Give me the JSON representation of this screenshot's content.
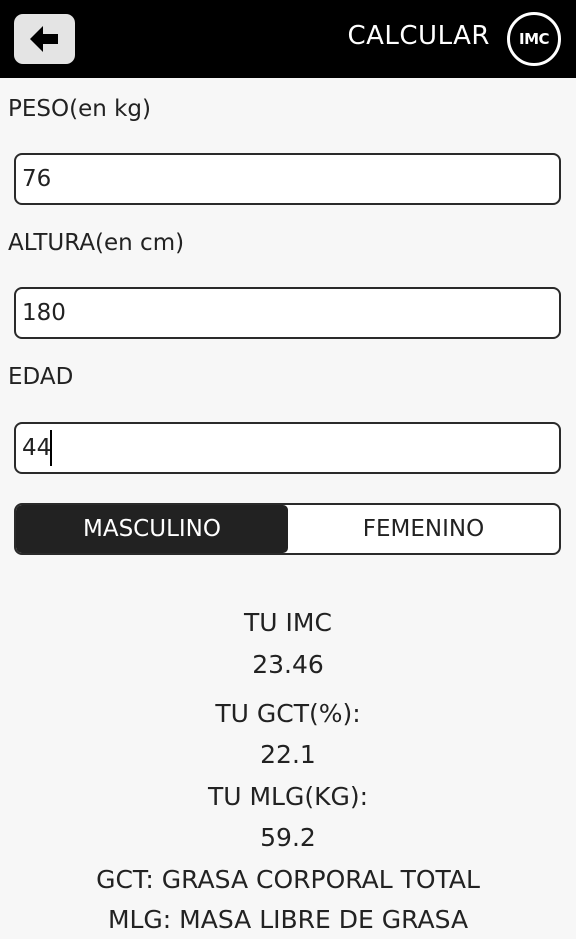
{
  "header": {
    "back_icon": "arrow-left-icon",
    "action_label": "CALCULAR",
    "badge_text": "IMC"
  },
  "form": {
    "weight": {
      "label": "PESO(en kg)",
      "value": "76"
    },
    "height": {
      "label": "ALTURA(en cm)",
      "value": "180"
    },
    "age": {
      "label": "EDAD",
      "value": "44"
    }
  },
  "gender": {
    "options": [
      "MASCULINO",
      "FEMENINO"
    ],
    "selected": "MASCULINO"
  },
  "results": {
    "imc_label": "TU IMC",
    "imc_value": "23.46",
    "gct_label": "TU GCT(%):",
    "gct_value": "22.1",
    "mlg_label": "TU MLG(KG):",
    "mlg_value": "59.2",
    "note_gct": "GCT: GRASA CORPORAL TOTAL",
    "note_mlg": "MLG: MASA LIBRE DE GRASA"
  },
  "colors": {
    "header_bg": "#000000",
    "selected_bg": "#222222",
    "page_bg": "#f7f7f7"
  }
}
